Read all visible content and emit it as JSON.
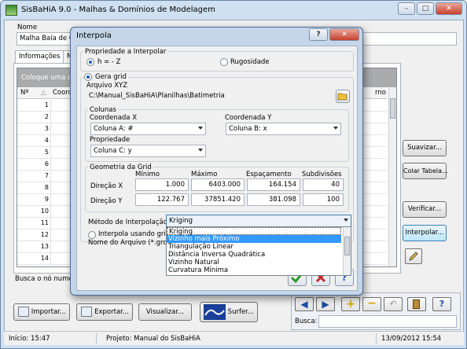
{
  "app": {
    "title": "SisBaHiA 9.0 - Malhas & Domínios de Modelagem"
  },
  "main": {
    "name_label": "Nome",
    "name_value": "Malha Baía de Gua",
    "tabs": [
      "Informações",
      "N"
    ],
    "grid_banner": "Coloque uma colu",
    "col_no": "Nº",
    "col_coord": "Coorden",
    "col_right": "rno",
    "rows": [
      "1",
      "2",
      "3",
      "4",
      "5",
      "6",
      "7",
      "8",
      "9",
      "10",
      "11",
      "12",
      "13",
      "14"
    ],
    "busca_no_label": "Busca o nó numero:"
  },
  "right_buttons": {
    "suavizar": "Suavizar...",
    "colar": "Colar Tabela...",
    "verificar": "Verificar...",
    "interpolar": "Interpolar..."
  },
  "bottom_buttons": {
    "importar": "Importar...",
    "exportar": "Exportar...",
    "visualizar": "Visualizar...",
    "surfer": "Surfer..."
  },
  "busca": {
    "label": "Busca:",
    "value": ""
  },
  "status": {
    "inicio": "Início: 15:47",
    "projeto": "Projeto: Manual do SisBaHiA",
    "datetime": "13/09/2012 15:54"
  },
  "dialog": {
    "title": "Interpola",
    "help_btn": "?",
    "group_prop": "Propriedade a Interpolar",
    "opt_h": "h = - Z",
    "opt_rug": "Rugosidade",
    "opt_gera": "Gera grid",
    "arquivo_label": "Arquivo XYZ",
    "arquivo_value": "C:\\Manual_SisBaHiA\\Planilhas\\Batimetria",
    "colunas_label": "Colunas",
    "coordx_label": "Coordenada X",
    "coordx_value": "Coluna A: #",
    "coordy_label": "Coordenada Y",
    "coordy_value": "Coluna B: x",
    "prop_label": "Propriedade",
    "prop_value": "Coluna C: y",
    "geom_label": "Geometria da Grid",
    "h_min": "Mínimo",
    "h_max": "Máximo",
    "h_esp": "Espaçamento",
    "h_sub": "Subdivisões",
    "dirx_label": "Direção X",
    "dirx": [
      "1.000",
      "6403.000",
      "164.154",
      "40"
    ],
    "diry_label": "Direção Y",
    "diry": [
      "122.767",
      "37851.420",
      "381.098",
      "100"
    ],
    "metodo_label": "Método de Interpolação:",
    "metodo_value": "Kriging",
    "interpola_grid_label": "Interpola usando grid de",
    "nome_arquivo_label": "Nome do Arquivo (*.grd)",
    "methods": [
      "Kriging",
      "Vizinho mais Próximo",
      "Triangulação Linear",
      "Distância Inversa Quadrática",
      "Vizinho Natural",
      "Curvatura Mínima"
    ],
    "selected_method_index": 1
  },
  "colors": {
    "selection": "#3399ff",
    "title_bg": "#cfe0f1",
    "dialog_frame": "#c5d6e9"
  }
}
